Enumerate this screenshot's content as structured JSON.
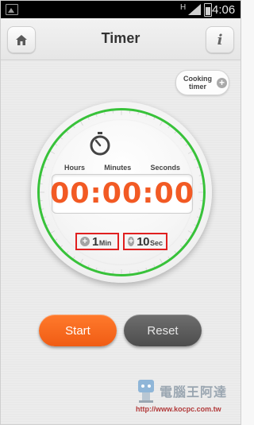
{
  "status_bar": {
    "network": "H",
    "time": "4:06"
  },
  "header": {
    "title": "Timer",
    "home_icon": "home-icon",
    "info_label": "i"
  },
  "cooking_timer": {
    "label": "Cooking timer"
  },
  "dial": {
    "ring_color": "#38c23a",
    "icon": "stopwatch-icon",
    "units": [
      "Hours",
      "Minutes",
      "Seconds"
    ],
    "display": "00:00:00",
    "display_color": "#f25a24"
  },
  "increments": {
    "minute": {
      "value": "1",
      "unit": "Min"
    },
    "second": {
      "value": "10",
      "unit": "Sec"
    }
  },
  "actions": {
    "start_label": "Start",
    "reset_label": "Reset"
  },
  "watermark": {
    "brand": "電腦王阿達",
    "url": "http://www.kocpc.com.tw"
  }
}
